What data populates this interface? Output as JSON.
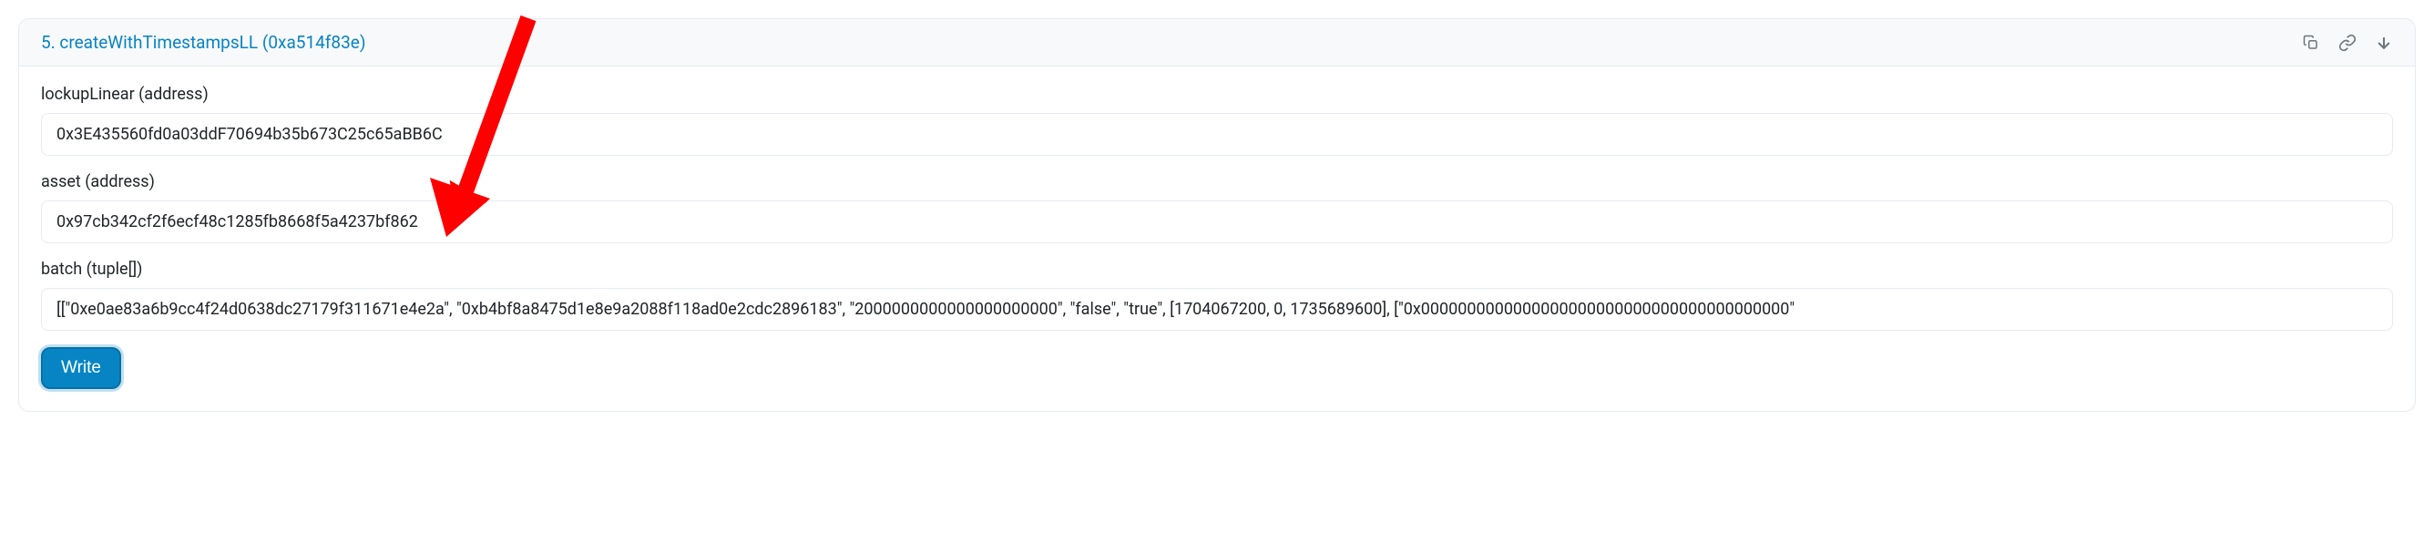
{
  "panel": {
    "index": "5",
    "title": "5. createWithTimestampsLL (0xa514f83e)"
  },
  "fields": {
    "lockupLinear": {
      "label": "lockupLinear (address)",
      "value": "0x3E435560fd0a03ddF70694b35b673C25c65aBB6C"
    },
    "asset": {
      "label": "asset (address)",
      "value": "0x97cb342cf2f6ecf48c1285fb8668f5a4237bf862"
    },
    "batch": {
      "label": "batch (tuple[])",
      "value": "[[\"0xe0ae83a6b9cc4f24d0638dc27179f311671e4e2a\", \"0xb4bf8a8475d1e8e9a2088f118ad0e2cdc2896183\", \"2000000000000000000000\", \"false\", \"true\", [1704067200, 0, 1735689600], [\"0x0000000000000000000000000000000000000000\""
    }
  },
  "actions": {
    "write": "Write"
  },
  "colors": {
    "accent": "#0784c3",
    "arrow": "#ff0000"
  }
}
